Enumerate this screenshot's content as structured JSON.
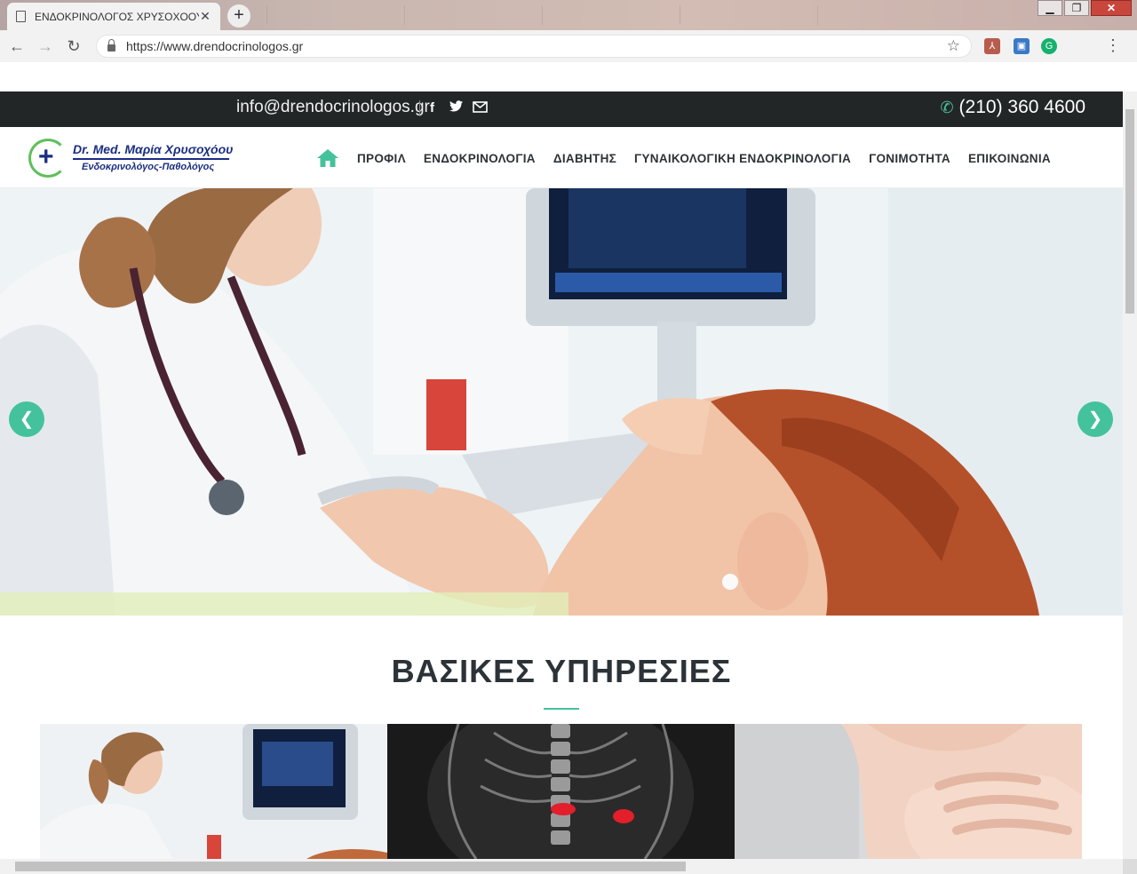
{
  "browser": {
    "tab_title": "ΕΝΔΟΚΡΙΝΟΛΟΓΟΣ ΧΡΥΣΟΧΟΟΥ",
    "url": "https://www.drendocrinologos.gr",
    "window_controls": {
      "minimize": "▁",
      "maximize": "❐",
      "close": "✕"
    }
  },
  "topbar": {
    "email": "info@drendocrinologos.gr",
    "phone": "(210) 360 4600",
    "social_icons": [
      "facebook-icon",
      "twitter-icon",
      "mail-icon"
    ]
  },
  "logo": {
    "name": "Dr. Med. Μαρία Χρυσοχόου",
    "subtitle": "Ενδοκρινολόγος-Παθολόγος"
  },
  "nav": {
    "items": [
      {
        "label": "ΠΡΟΦΙΛ"
      },
      {
        "label": "ΕΝΔΟΚΡΙΝΟΛΟΓΙΑ"
      },
      {
        "label": "ΔΙΑΒΗΤΗΣ"
      },
      {
        "label": "ΓΥΝΑΙΚΟΛΟΓΙΚΗ ΕΝΔΟΚΡΙΝΟΛΟΓΙΑ"
      },
      {
        "label": "ΓΟΝΙΜΟΤΗΤΑ"
      },
      {
        "label": "ΕΠΙΚΟΙΝΩΝΙΑ"
      }
    ]
  },
  "hero": {
    "prev_label": "❮",
    "next_label": "❯"
  },
  "services": {
    "title": "ΒΑΣΙΚΕΣ ΥΠΗΡΕΣΙΕΣ"
  },
  "colors": {
    "accent": "#44c29b",
    "topbar_bg": "#222627",
    "nav_text": "#2c3338",
    "logo_blue": "#1a2e82",
    "logo_green": "#5fbf5b"
  }
}
